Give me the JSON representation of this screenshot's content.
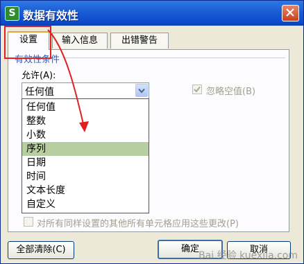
{
  "window": {
    "title": "数据有效性",
    "app_icon": "S"
  },
  "tabs": [
    {
      "label": "设置",
      "active": true
    },
    {
      "label": "输入信息",
      "active": false
    },
    {
      "label": "出错警告",
      "active": false
    }
  ],
  "settings": {
    "group_title": "有效性条件",
    "allow_label": "允许(A):",
    "allow_value": "任何值",
    "ignore_blank_label": "忽略空值(B)",
    "ignore_blank_checked": true,
    "apply_all_label": "对所有同样设置的其他所有单元格应用这些更改(P)",
    "apply_all_checked": false
  },
  "dropdown": {
    "options": [
      "任何值",
      "整数",
      "小数",
      "序列",
      "日期",
      "时间",
      "文本长度",
      "自定义"
    ],
    "highlighted": "序列"
  },
  "buttons": {
    "clear_all": "全部清除(C)",
    "ok": "确定",
    "cancel": "取消"
  },
  "watermark": "Bai 经验 kuexila.com",
  "colors": {
    "title_bar": "#1b5ed6",
    "highlight": "#b7cfa0",
    "annotation": "#e02020"
  }
}
